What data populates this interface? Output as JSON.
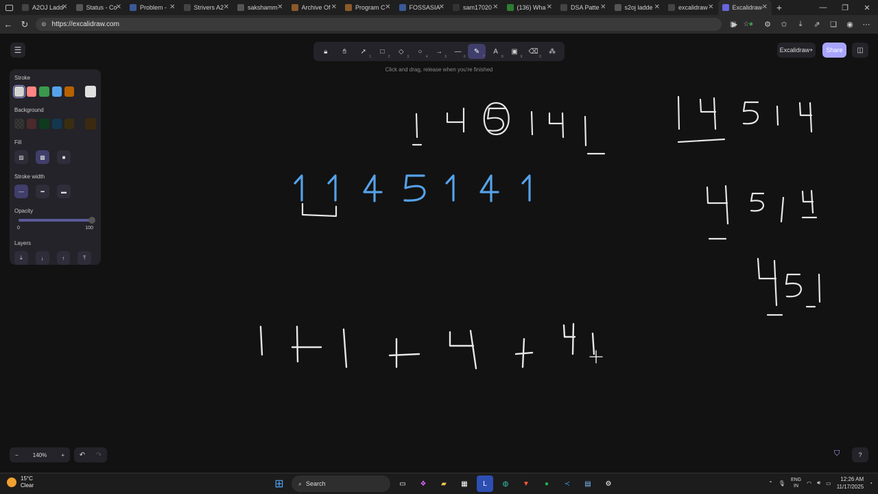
{
  "browser": {
    "tabs": [
      {
        "title": "A2OJ Ladde",
        "color": "#444"
      },
      {
        "title": "Status - Co",
        "color": "#555"
      },
      {
        "title": "Problem -",
        "color": "#3b5998"
      },
      {
        "title": "Strivers A2",
        "color": "#444"
      },
      {
        "title": "sakshamm",
        "color": "#555"
      },
      {
        "title": "Archive Of",
        "color": "#8b5a2b"
      },
      {
        "title": "Program C",
        "color": "#8b5a2b"
      },
      {
        "title": "FOSSASIA",
        "color": "#3b5998"
      },
      {
        "title": "sam17020",
        "color": "#333"
      },
      {
        "title": "(136) Wha",
        "color": "#2e7d32"
      },
      {
        "title": "DSA Patte",
        "color": "#444"
      },
      {
        "title": "s2oj ladde",
        "color": "#555"
      },
      {
        "title": "excalidraw",
        "color": "#444"
      },
      {
        "title": "Excalidraw",
        "color": "#6965db",
        "active": true
      }
    ],
    "url": "https://excalidraw.com"
  },
  "toolbar": {
    "tools": [
      {
        "name": "lock-tool",
        "glyph": "🔒︎",
        "key": ""
      },
      {
        "name": "hand-tool",
        "glyph": "✋︎",
        "key": ""
      },
      {
        "name": "selection-tool",
        "glyph": "➚",
        "key": "1"
      },
      {
        "name": "rectangle-tool",
        "glyph": "□",
        "key": "2"
      },
      {
        "name": "diamond-tool",
        "glyph": "◇",
        "key": "3"
      },
      {
        "name": "ellipse-tool",
        "glyph": "○",
        "key": "4"
      },
      {
        "name": "arrow-tool",
        "glyph": "→",
        "key": "5"
      },
      {
        "name": "line-tool",
        "glyph": "—",
        "key": "6"
      },
      {
        "name": "draw-tool",
        "glyph": "✎",
        "key": "7",
        "active": true
      },
      {
        "name": "text-tool",
        "glyph": "A",
        "key": "8"
      },
      {
        "name": "image-tool",
        "glyph": "▣",
        "key": "9"
      },
      {
        "name": "eraser-tool",
        "glyph": "⌫",
        "key": "0"
      },
      {
        "name": "more-tools",
        "glyph": "⁂",
        "key": ""
      }
    ],
    "hint": "Click and drag, release when you're finished"
  },
  "header": {
    "plus_label": "Excalidraw+",
    "share_label": "Share"
  },
  "panel": {
    "stroke_label": "Stroke",
    "stroke_colors": [
      "#d3d3d3",
      "#ff8383",
      "#3a994c",
      "#56a2e8",
      "#b76100"
    ],
    "stroke_current": "#e0e0e0",
    "background_label": "Background",
    "background_colors": [
      "transparent",
      "#4a2a2a",
      "#0e3b1e",
      "#12384f",
      "#3b2e10"
    ],
    "background_current": "#3b2a10",
    "fill_label": "Fill",
    "fill_options": [
      "hachure",
      "cross-hatch",
      "solid"
    ],
    "stroke_width_label": "Stroke width",
    "stroke_widths": [
      "thin",
      "bold",
      "extra-bold"
    ],
    "opacity_label": "Opacity",
    "opacity_min": "0",
    "opacity_max": "100",
    "opacity_value": 100,
    "layers_label": "Layers",
    "layer_actions": [
      "send-to-back",
      "send-backward",
      "bring-forward",
      "bring-to-front"
    ]
  },
  "footer": {
    "zoom": "140%",
    "zoom_out": "−",
    "zoom_in": "+"
  },
  "taskbar": {
    "temperature": "15°C",
    "weather": "Clear",
    "search_placeholder": "Search",
    "lang_line1": "ENG",
    "lang_line2": "IN",
    "time": "12:26 AM",
    "date": "11/17/2025"
  }
}
